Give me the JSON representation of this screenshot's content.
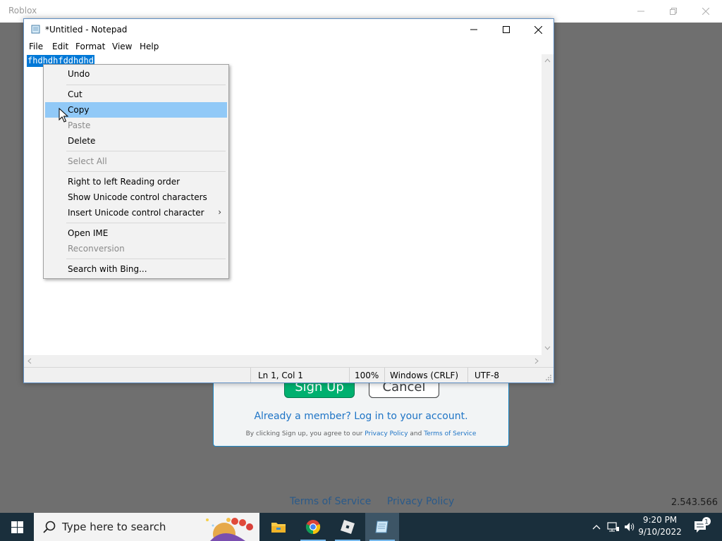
{
  "roblox": {
    "title": "Roblox",
    "signup_label": "Sign Up",
    "cancel_label": "Cancel",
    "already_member": "Already a member? Log in to your account.",
    "terms_prefix": "By clicking Sign up, you agree to our",
    "privacy_link": "Privacy Policy",
    "terms_and": "and",
    "terms_link": "Terms of Service",
    "footer_terms": "Terms of Service",
    "footer_privacy": "Privacy Policy",
    "version": "2.543.566"
  },
  "notepad": {
    "title": "*Untitled - Notepad",
    "menu": [
      "File",
      "Edit",
      "Format",
      "View",
      "Help"
    ],
    "selected_text": "fhdhdhfddhdhd",
    "status": {
      "position": "Ln 1, Col 1",
      "zoom": "100%",
      "line_ending": "Windows (CRLF)",
      "encoding": "UTF-8"
    }
  },
  "context_menu": {
    "items": [
      {
        "label": "Undo",
        "enabled": true
      },
      {
        "label": "Cut",
        "enabled": true
      },
      {
        "label": "Copy",
        "enabled": true,
        "active": true
      },
      {
        "label": "Paste",
        "enabled": false
      },
      {
        "label": "Delete",
        "enabled": true
      },
      {
        "label": "Select All",
        "enabled": false
      },
      {
        "label": "Right to left Reading order",
        "enabled": true
      },
      {
        "label": "Show Unicode control characters",
        "enabled": true
      },
      {
        "label": "Insert Unicode control character",
        "enabled": true,
        "submenu": true
      },
      {
        "label": "Open IME",
        "enabled": true
      },
      {
        "label": "Reconversion",
        "enabled": false
      },
      {
        "label": "Search with Bing...",
        "enabled": true
      }
    ]
  },
  "taskbar": {
    "search_placeholder": "Type here to search",
    "time": "9:20 PM",
    "date": "9/10/2022",
    "apps": [
      "file-explorer-icon",
      "chrome-icon",
      "roblox-icon",
      "notepad-icon"
    ]
  },
  "colors": {
    "selection": "#0078d7",
    "menu_highlight": "#91c9f7",
    "taskbar": "#1a2f3c",
    "roblox_green": "#00b06f",
    "link_blue": "#1e74c6"
  }
}
